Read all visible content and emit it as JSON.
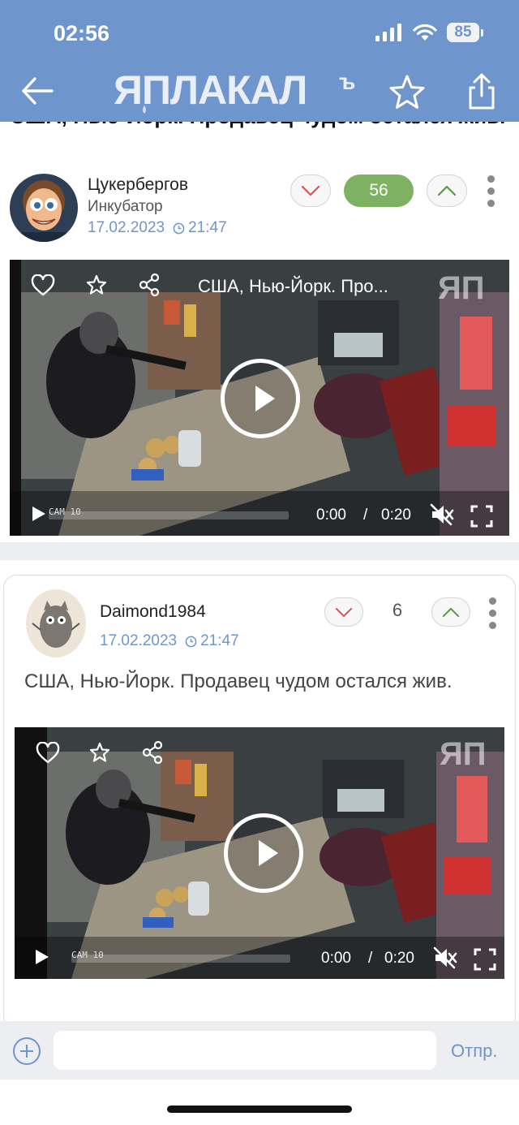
{
  "status_bar": {
    "time": "02:56",
    "battery": "85"
  },
  "header": {
    "logo": "ЯПЛАКАЛЪ",
    "logo_suffix": "ъ"
  },
  "post": {
    "title": "США, Нью-Йорк. Продавец чудом остался жив.",
    "author": "Цукербергов",
    "rank": "Инкубатор",
    "date": "17.02.2023",
    "time": "21:47",
    "score": "56",
    "video": {
      "title": "США, Нью-Йорк. Про...",
      "watermark": "ЯП",
      "cam_label": "CAM 10",
      "current_time": "0:00",
      "separator": "/",
      "duration": "0:20",
      "progress": 0
    }
  },
  "comment": {
    "author": "Daimond1984",
    "date": "17.02.2023",
    "time": "21:47",
    "score": "6",
    "text": "США, Нью-Йорк. Продавец чудом остался жив.",
    "video": {
      "watermark": "ЯП",
      "cam_label": "CAM 10",
      "current_time": "0:00",
      "separator": "/",
      "duration": "0:20",
      "progress": 0
    }
  },
  "composer": {
    "placeholder": "",
    "send_label": "Отпр."
  },
  "colors": {
    "header_bg": "#6f95cd",
    "score_bg": "#7eb262",
    "date_text": "#6f95cd",
    "downvote": "#d9534f",
    "upvote": "#5a9a3c"
  },
  "icons": [
    "back-arrow-icon",
    "star-icon",
    "share-icon",
    "chevron-down-icon",
    "chevron-up-icon",
    "kebab-icon",
    "heart-icon",
    "network-share-icon",
    "play-icon",
    "mute-icon",
    "fullscreen-icon",
    "clock-icon",
    "add-icon"
  ]
}
